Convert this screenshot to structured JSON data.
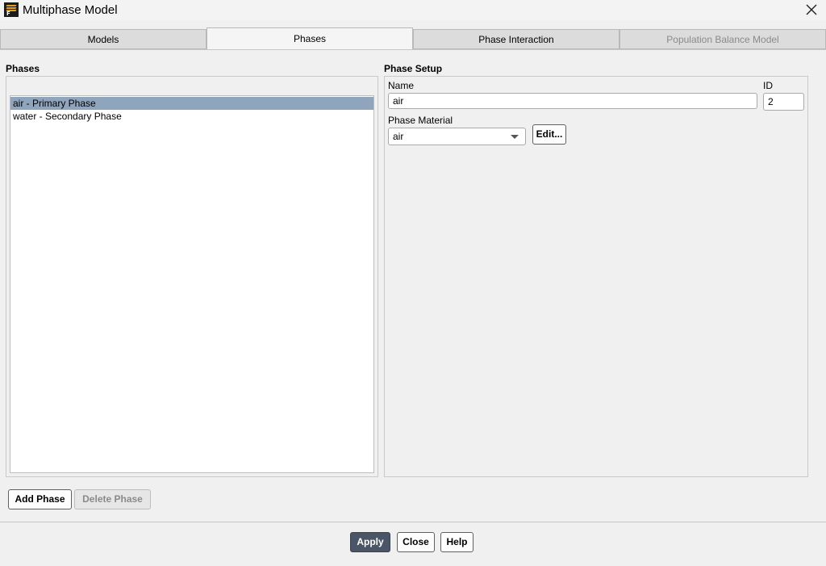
{
  "window": {
    "title": "Multiphase Model",
    "close_glyph": "✕"
  },
  "tabs": [
    {
      "label": "Models",
      "state": "normal"
    },
    {
      "label": "Phases",
      "state": "active"
    },
    {
      "label": "Phase Interaction",
      "state": "normal"
    },
    {
      "label": "Population Balance Model",
      "state": "disabled"
    }
  ],
  "phases": {
    "header": "Phases",
    "items": [
      {
        "label": "air - Primary Phase",
        "selected": true
      },
      {
        "label": "water - Secondary Phase",
        "selected": false
      }
    ],
    "add_button": "Add Phase",
    "delete_button": "Delete Phase"
  },
  "phase_setup": {
    "header": "Phase Setup",
    "name_label": "Name",
    "name_value": "air",
    "id_label": "ID",
    "id_value": "2",
    "material_label": "Phase Material",
    "material_value": "air",
    "edit_button": "Edit..."
  },
  "footer": {
    "apply": "Apply",
    "close": "Close",
    "help": "Help"
  },
  "colors": {
    "selection": "#8fa5bd",
    "apply_button": "#4a5566"
  },
  "icons": {
    "app": "fluent-app-icon",
    "close": "close-icon",
    "dropdown": "chevron-down-icon"
  }
}
